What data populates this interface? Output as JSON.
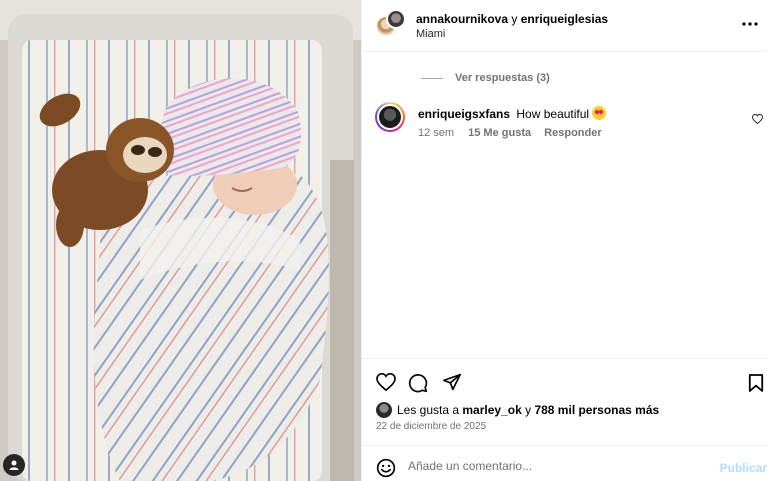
{
  "header": {
    "user1": "annakournikova",
    "separator": "y",
    "user2": "enriqueiglesias",
    "location": "Miami",
    "more_icon": "more-horizontal-icon"
  },
  "comments": {
    "view_replies": "Ver respuestas (3)",
    "items": [
      {
        "username": "enriqueigsxfans",
        "text": "How beautiful",
        "emoji": "heart-eyes-emoji",
        "time": "12 sem",
        "likes": "15 Me gusta",
        "reply": "Responder"
      }
    ]
  },
  "actions": {
    "icons": [
      "heart-icon",
      "comment-icon",
      "share-icon",
      "bookmark-icon"
    ]
  },
  "likes": {
    "prefix": "Les gusta a",
    "user": "marley_ok",
    "conj": "y",
    "count": "788 mil personas más"
  },
  "date": "22 de diciembre de 2025",
  "add_comment": {
    "placeholder": "Añade un comentario...",
    "publish": "Publicar",
    "emoji_icon": "smiley-icon"
  },
  "colors": {
    "publish_disabled": "#b3dbff",
    "secondary_text": "#737373",
    "divider": "#efefef"
  }
}
